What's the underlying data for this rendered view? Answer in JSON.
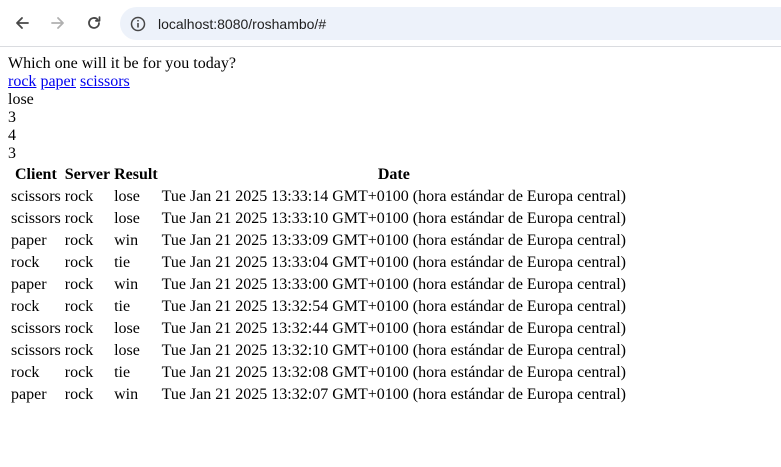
{
  "browser": {
    "url": "localhost:8080/roshambo/#",
    "colors": {
      "address_bg": "#edf2fa",
      "icon": "#474747"
    }
  },
  "page": {
    "prompt": "Which one will it be for you today?",
    "choices": [
      "rock",
      "paper",
      "scissors"
    ],
    "last_result": "lose",
    "counts": [
      "3",
      "4",
      "3"
    ]
  },
  "history": {
    "headers": [
      "Client",
      "Server",
      "Result",
      "Date"
    ],
    "rows": [
      [
        "scissors",
        "rock",
        "lose",
        "Tue Jan 21 2025 13:33:14 GMT+0100 (hora estándar de Europa central)"
      ],
      [
        "scissors",
        "rock",
        "lose",
        "Tue Jan 21 2025 13:33:10 GMT+0100 (hora estándar de Europa central)"
      ],
      [
        "paper",
        "rock",
        "win",
        "Tue Jan 21 2025 13:33:09 GMT+0100 (hora estándar de Europa central)"
      ],
      [
        "rock",
        "rock",
        "tie",
        "Tue Jan 21 2025 13:33:04 GMT+0100 (hora estándar de Europa central)"
      ],
      [
        "paper",
        "rock",
        "win",
        "Tue Jan 21 2025 13:33:00 GMT+0100 (hora estándar de Europa central)"
      ],
      [
        "rock",
        "rock",
        "tie",
        "Tue Jan 21 2025 13:32:54 GMT+0100 (hora estándar de Europa central)"
      ],
      [
        "scissors",
        "rock",
        "lose",
        "Tue Jan 21 2025 13:32:44 GMT+0100 (hora estándar de Europa central)"
      ],
      [
        "scissors",
        "rock",
        "lose",
        "Tue Jan 21 2025 13:32:10 GMT+0100 (hora estándar de Europa central)"
      ],
      [
        "rock",
        "rock",
        "tie",
        "Tue Jan 21 2025 13:32:08 GMT+0100 (hora estándar de Europa central)"
      ],
      [
        "paper",
        "rock",
        "win",
        "Tue Jan 21 2025 13:32:07 GMT+0100 (hora estándar de Europa central)"
      ]
    ]
  }
}
